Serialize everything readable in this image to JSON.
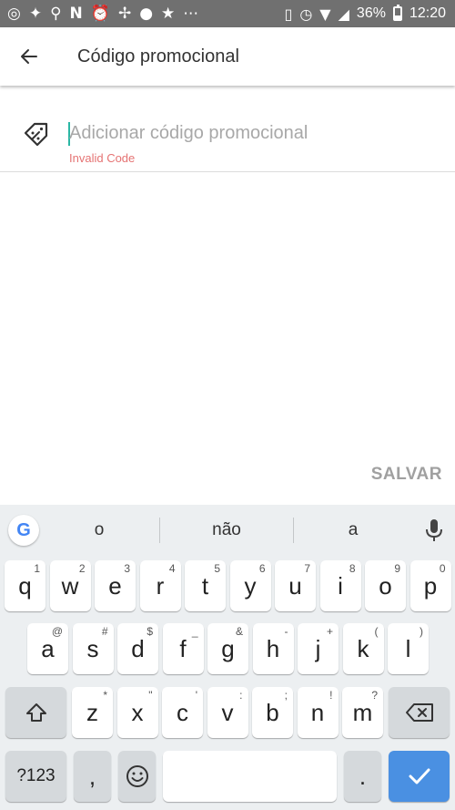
{
  "status_bar": {
    "battery": "36%",
    "time": "12:20",
    "battery_level": 0.36,
    "notification_icons": [
      "instagram-icon",
      "fish-icon",
      "location-pin-icon",
      "netflix-n-icon",
      "alarm-icon",
      "pinwheel-icon",
      "chat-icon",
      "star-icon",
      "more-dots-icon"
    ]
  },
  "app_bar": {
    "title": "Código promocional"
  },
  "promo": {
    "placeholder": "Adicionar código promocional",
    "value": "",
    "error": "Invalid Code"
  },
  "actions": {
    "save": "SALVAR"
  },
  "keyboard": {
    "suggestions": [
      "o",
      "não",
      "a"
    ],
    "row1": [
      {
        "key": "q",
        "sup": "1"
      },
      {
        "key": "w",
        "sup": "2"
      },
      {
        "key": "e",
        "sup": "3"
      },
      {
        "key": "r",
        "sup": "4"
      },
      {
        "key": "t",
        "sup": "5"
      },
      {
        "key": "y",
        "sup": "6"
      },
      {
        "key": "u",
        "sup": "7"
      },
      {
        "key": "i",
        "sup": "8"
      },
      {
        "key": "o",
        "sup": "9"
      },
      {
        "key": "p",
        "sup": "0"
      }
    ],
    "row2": [
      {
        "key": "a",
        "sup": "@"
      },
      {
        "key": "s",
        "sup": "#"
      },
      {
        "key": "d",
        "sup": "$"
      },
      {
        "key": "f",
        "sup": "_"
      },
      {
        "key": "g",
        "sup": "&"
      },
      {
        "key": "h",
        "sup": "-"
      },
      {
        "key": "j",
        "sup": "+"
      },
      {
        "key": "k",
        "sup": "("
      },
      {
        "key": "l",
        "sup": ")"
      }
    ],
    "row3": [
      {
        "key": "z",
        "sup": "*"
      },
      {
        "key": "x",
        "sup": "\""
      },
      {
        "key": "c",
        "sup": "'"
      },
      {
        "key": "v",
        "sup": ":"
      },
      {
        "key": "b",
        "sup": ";"
      },
      {
        "key": "n",
        "sup": "!"
      },
      {
        "key": "m",
        "sup": "?"
      }
    ],
    "symbols": "?123",
    "comma": ",",
    "period": "."
  }
}
